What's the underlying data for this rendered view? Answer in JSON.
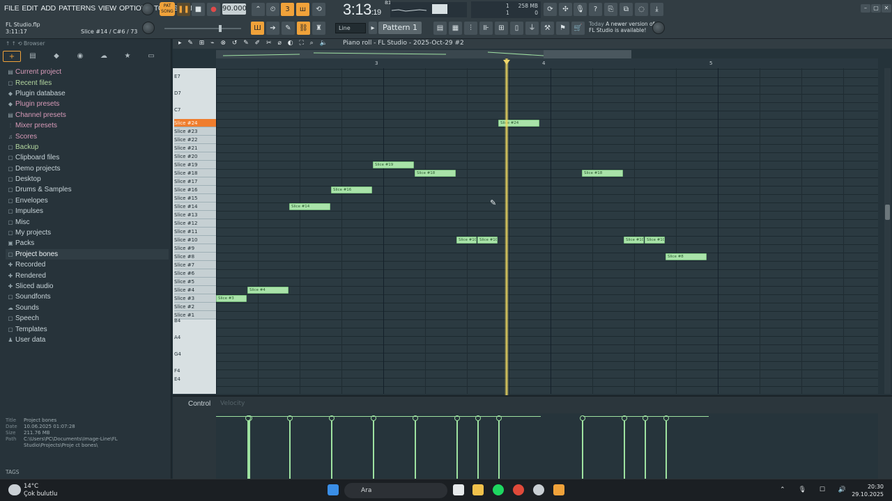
{
  "menus": [
    "FILE",
    "EDIT",
    "ADD",
    "PATTERNS",
    "VIEW",
    "OPTIONS",
    "TOOLS",
    "HELP"
  ],
  "transport": {
    "pat_label": "PAT",
    "song_label": "SONG",
    "tempo": "90.000",
    "time_main": "3:13",
    "time_sub": "19",
    "time_beat": "8:1"
  },
  "cpu": {
    "voices": "1",
    "ram": "258 MB",
    "poly": "1",
    "cpu_label": "0"
  },
  "project": {
    "file": "FL Studio.flp",
    "time": "3:11:17",
    "hint": "Slice #14 / C#6 / 73"
  },
  "snap": "Line",
  "pattern": "Pattern 1",
  "news": {
    "today": "Today",
    "line1": "A newer version of",
    "line2": "FL Studio is available!"
  },
  "browser": {
    "title": "Browser",
    "items": [
      {
        "label": "Current project",
        "icon": "▤",
        "style": "pink"
      },
      {
        "label": "Recent files",
        "icon": "▢",
        "style": "green"
      },
      {
        "label": "Plugin database",
        "icon": "◆",
        "style": ""
      },
      {
        "label": "Plugin presets",
        "icon": "◆",
        "style": "pink"
      },
      {
        "label": "Channel presets",
        "icon": "▤",
        "style": "pink"
      },
      {
        "label": "Mixer presets",
        "icon": "⫶",
        "style": "pink"
      },
      {
        "label": "Scores",
        "icon": "♫",
        "style": "pink"
      },
      {
        "label": "Backup",
        "icon": "▢",
        "style": "green"
      },
      {
        "label": "Clipboard files",
        "icon": "▢",
        "style": ""
      },
      {
        "label": "Demo projects",
        "icon": "▢",
        "style": ""
      },
      {
        "label": "Desktop",
        "icon": "▢",
        "style": ""
      },
      {
        "label": "Drums & Samples",
        "icon": "▢",
        "style": ""
      },
      {
        "label": "Envelopes",
        "icon": "▢",
        "style": ""
      },
      {
        "label": "Impulses",
        "icon": "▢",
        "style": ""
      },
      {
        "label": "Misc",
        "icon": "▢",
        "style": ""
      },
      {
        "label": "My projects",
        "icon": "▢",
        "style": ""
      },
      {
        "label": "Packs",
        "icon": "▣",
        "style": ""
      },
      {
        "label": "Project bones",
        "icon": "▢",
        "style": "active"
      },
      {
        "label": "Recorded",
        "icon": "✚",
        "style": ""
      },
      {
        "label": "Rendered",
        "icon": "✚",
        "style": ""
      },
      {
        "label": "Sliced audio",
        "icon": "✚",
        "style": ""
      },
      {
        "label": "Soundfonts",
        "icon": "▢",
        "style": ""
      },
      {
        "label": "Sounds",
        "icon": "☁",
        "style": ""
      },
      {
        "label": "Speech",
        "icon": "▢",
        "style": ""
      },
      {
        "label": "Templates",
        "icon": "▢",
        "style": ""
      },
      {
        "label": "User data",
        "icon": "♟",
        "style": ""
      }
    ],
    "meta": {
      "title_k": "Title",
      "title_v": "Project bones",
      "date_k": "Date",
      "date_v": "10.06.2025 01:07:28",
      "size_k": "Size",
      "size_v": "211.76 MB",
      "path_k": "Path",
      "path_v": "C:\\Users\\PC\\Documents\\Image-Line\\FL Studio\\Projects\\Proje ct bones\\"
    },
    "tags": "TAGS"
  },
  "pianoroll": {
    "title": "Piano roll - FL Studio - 2025-Oct-29 #2",
    "ruler": [
      "3",
      "4",
      "5"
    ],
    "control_label": "Control",
    "control_target": "Velocity",
    "keys_top": [
      "E7",
      "D7",
      "C7"
    ],
    "keys_bottom": [
      "B4",
      "A4",
      "G4",
      "F4",
      "E4"
    ],
    "slices": [
      "Slice #24",
      "Slice #23",
      "Slice #22",
      "Slice #21",
      "Slice #20",
      "Slice #19",
      "Slice #18",
      "Slice #17",
      "Slice #16",
      "Slice #15",
      "Slice #14",
      "Slice #13",
      "Slice #12",
      "Slice #11",
      "Slice #10",
      "Slice #9",
      "Slice #8",
      "Slice #7",
      "Slice #6",
      "Slice #5",
      "Slice #4",
      "Slice #3",
      "Slice #2",
      "Slice #1"
    ],
    "selected_slice": "Slice #24",
    "notes": [
      {
        "label": "Slice #3",
        "slice": 3,
        "start": 0.0,
        "len": 0.75
      },
      {
        "label": "Slice #4",
        "slice": 4,
        "start": 0.75,
        "len": 1.0
      },
      {
        "label": "Slice #14",
        "slice": 14,
        "start": 1.75,
        "len": 1.0
      },
      {
        "label": "Slice #16",
        "slice": 16,
        "start": 2.75,
        "len": 1.0
      },
      {
        "label": "Slice #19",
        "slice": 19,
        "start": 3.75,
        "len": 1.0
      },
      {
        "label": "Slice #18",
        "slice": 18,
        "start": 4.75,
        "len": 1.0
      },
      {
        "label": "Slice #10",
        "slice": 10,
        "start": 5.75,
        "len": 0.5
      },
      {
        "label": "Slice #10",
        "slice": 10,
        "start": 6.25,
        "len": 0.5
      },
      {
        "label": "Slice #24",
        "slice": 24,
        "start": 6.75,
        "len": 1.0
      },
      {
        "label": "Slice #18",
        "slice": 18,
        "start": 8.75,
        "len": 1.0
      },
      {
        "label": "Slice #10",
        "slice": 10,
        "start": 9.75,
        "len": 0.5
      },
      {
        "label": "Slice #10",
        "slice": 10,
        "start": 10.25,
        "len": 0.5
      },
      {
        "label": "Slice #8",
        "slice": 8,
        "start": 10.75,
        "len": 1.0
      }
    ],
    "playhead_beat": 6.95
  },
  "taskbar": {
    "temp": "14°C",
    "weather": "Çok bulutlu",
    "search": "Ara",
    "time": "20:30",
    "date": "29.10.2025"
  },
  "colors": {
    "accent": "#f0a23a",
    "note": "#a9e3a9",
    "selected_key": "#ef7d2e",
    "playhead": "#ebd660"
  }
}
